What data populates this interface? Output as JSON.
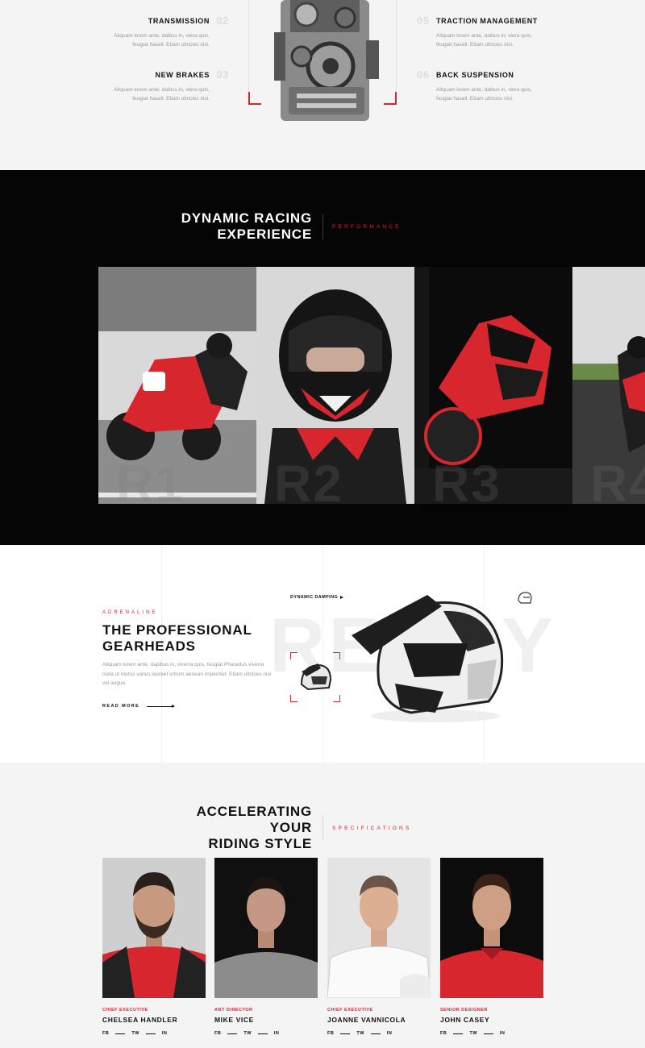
{
  "features": {
    "items": [
      {
        "title": "TRANSMISSION",
        "number": "02",
        "desc1": "Aliquam lorem ante, daibus in, viera quis,",
        "desc2": "feugiat hasell. Etiam ultricies nisi."
      },
      {
        "title": "NEW BRAKES",
        "number": "03",
        "desc1": "Aliquam lorem ante, daibus in, viera quis,",
        "desc2": "feugiat hasell. Etiam ultricies nisi."
      },
      {
        "title": "TRACTION MANAGEMENT",
        "number": "05",
        "desc1": "Aliquam lorem ante, daibus in, viera quis,",
        "desc2": "feugiat hasell. Etiam ultricies nisi."
      },
      {
        "title": "BACK SUSPENSION",
        "number": "06",
        "desc1": "Aliquam lorem ante, daibus in, viera quis,",
        "desc2": "feugiat hasell. Etiam ultricies nisi."
      }
    ]
  },
  "racing": {
    "title_line1": "DYNAMIC RACING",
    "title_line2": "EXPERIENCE",
    "tag": "PERFORMANCE",
    "tiles": [
      "R1",
      "R2",
      "R3",
      "R4"
    ]
  },
  "gearheads": {
    "eyebrow": "ADRENALINE",
    "title_line1": "THE PROFESSIONAL",
    "title_line2": "GEARHEADS",
    "desc": "Aliquam lorem ante, dapibus in, viverra quis, feugiat Phasellus viverra nulla ut metus varius laoreet srtrum aenean imperdiet. Etiam ultricies nisi vel augue.",
    "read_more": "READ MORE",
    "ghost_word": "READY",
    "damping_label": "DYNAMIC DAMPING"
  },
  "team": {
    "title_line1": "ACCELERATING YOUR",
    "title_line2": "RIDING STYLE",
    "tag": "SPECIFICATIONS",
    "socials": [
      "FB",
      "TW",
      "IN"
    ],
    "members": [
      {
        "role": "CHIEF EXECUTIVE",
        "name": "CHELSEA HANDLER"
      },
      {
        "role": "ART DIRECTOR",
        "name": "MIKE VICE"
      },
      {
        "role": "CHIEF EXECUTIVE",
        "name": "JOANNE VANNICOLA"
      },
      {
        "role": "SENIOR DESIGNER",
        "name": "JOHN CASEY"
      }
    ]
  },
  "colors": {
    "accent": "#d8262e",
    "dark": "#050505",
    "light": "#f4f4f4"
  }
}
